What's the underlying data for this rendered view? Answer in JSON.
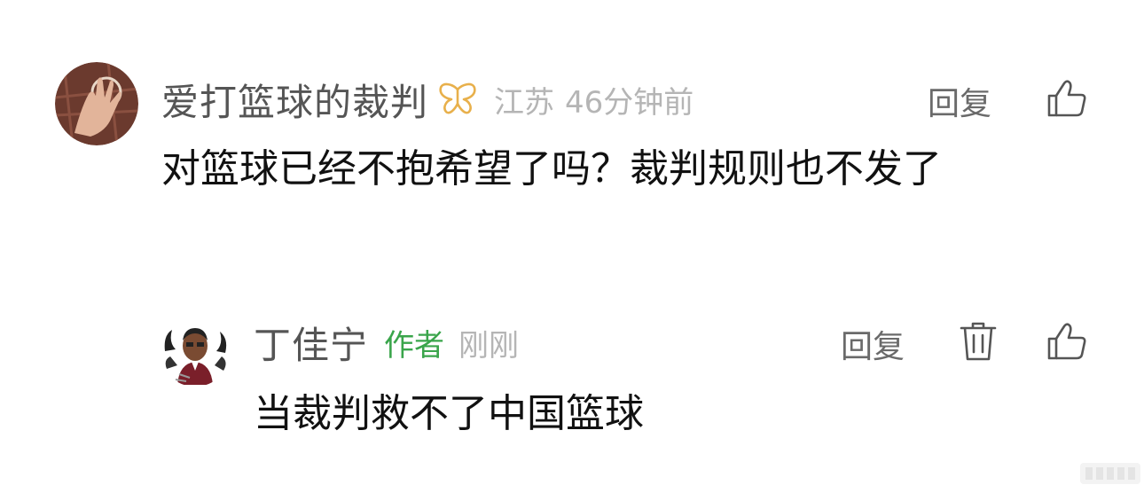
{
  "comment": {
    "username": "爱打篮球的裁判",
    "badge_icon": "butterfly-badge-icon",
    "location": "江苏",
    "time": "46分钟前",
    "reply_label": "回复",
    "like_icon": "thumbs-up-icon",
    "text": "对篮球已经不抱希望了吗？裁判规则也不发了",
    "reply": {
      "username": "丁佳宁",
      "author_tag": "作者",
      "time": "刚刚",
      "reply_label": "回复",
      "delete_icon": "trash-icon",
      "like_icon": "thumbs-up-icon",
      "text": "当裁判救不了中国篮球"
    }
  },
  "colors": {
    "name": "#555555",
    "meta": "#b5b5b5",
    "author_tag": "#3aa54b",
    "badge": "#e8b04b",
    "text": "#111111"
  }
}
